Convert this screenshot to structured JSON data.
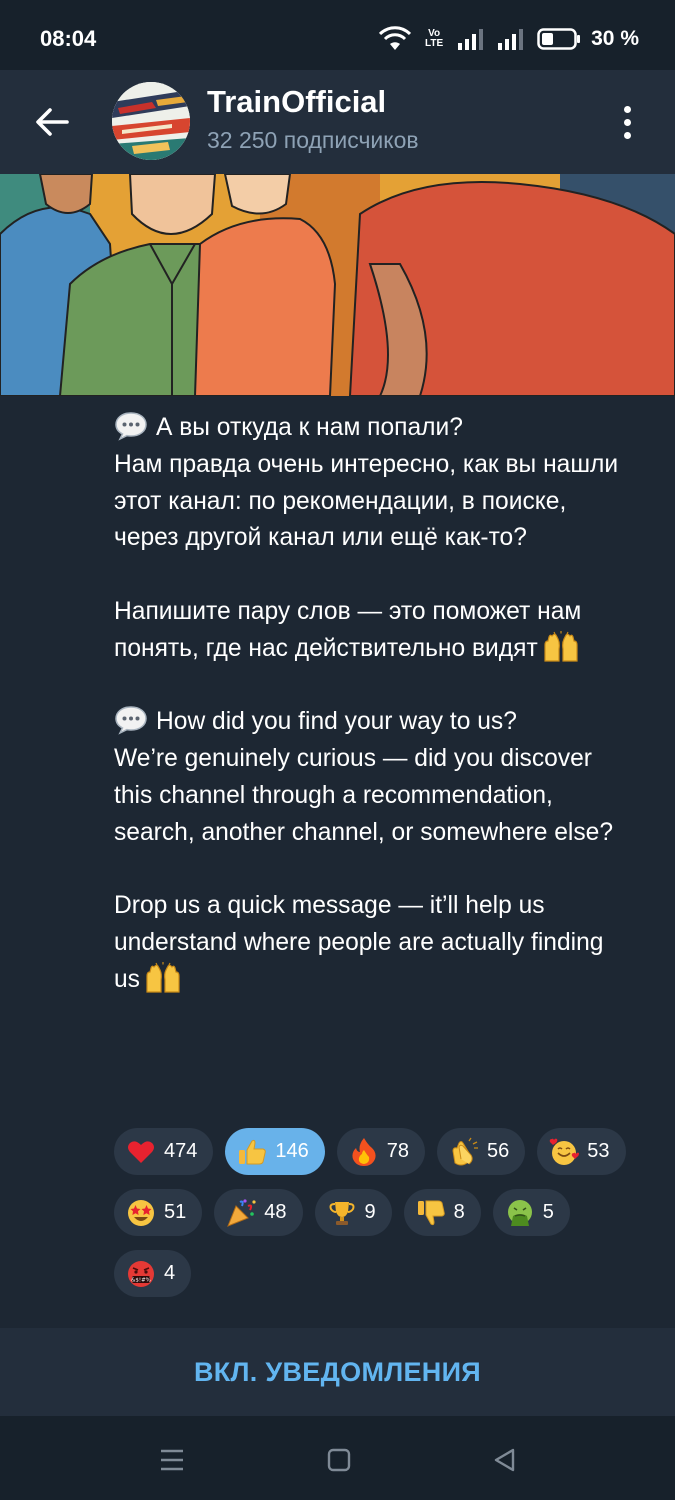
{
  "status_bar": {
    "time": "08:04",
    "network_label": "Vo LTE",
    "battery_percent": "30 %"
  },
  "header": {
    "title": "TrainOfficial",
    "subscribers": "32 250 подписчиков",
    "back_icon": "arrow-left-icon",
    "menu_icon": "more-vertical-icon"
  },
  "post": {
    "paragraphs": [
      "А вы откуда к нам попали?\nНам правда очень интересно, как вы нашли этот канал: по рекомендации, в поиске, через другой канал или ещё как-то?",
      "Напишите пару слов — это поможет нам понять, где нас действительно видят",
      "How did you find your way to us?\nWe’re genuinely curious — did you discover this channel through a recommendation, search, another channel, or somewhere else?",
      "Drop us a quick message — it’ll help us understand where people are actually finding us"
    ]
  },
  "reactions": [
    {
      "emoji": "red-heart",
      "count": "474",
      "active": false
    },
    {
      "emoji": "thumbs-up",
      "count": "146",
      "active": true
    },
    {
      "emoji": "fire",
      "count": "78",
      "active": false
    },
    {
      "emoji": "clapping-hands",
      "count": "56",
      "active": false
    },
    {
      "emoji": "smiling-face-with-hearts",
      "count": "53",
      "active": false
    },
    {
      "emoji": "star-struck",
      "count": "51",
      "active": false
    },
    {
      "emoji": "party-popper",
      "count": "48",
      "active": false
    },
    {
      "emoji": "trophy",
      "count": "9",
      "active": false
    },
    {
      "emoji": "thumbs-down",
      "count": "8",
      "active": false
    },
    {
      "emoji": "nauseated-face",
      "count": "5",
      "active": false
    },
    {
      "emoji": "face-with-symbols",
      "count": "4",
      "active": false
    }
  ],
  "notify_button": {
    "label": "ВКЛ. УВЕДОМЛЕНИЯ"
  },
  "nav": {
    "icons": [
      "recents-icon",
      "home-icon",
      "back-triangle-icon"
    ]
  },
  "colors": {
    "background": "#1d2733",
    "header": "#232e3c",
    "accent": "#62b5f0",
    "reaction_active": "#68b2ea",
    "reaction_chip": "#2c3847"
  }
}
